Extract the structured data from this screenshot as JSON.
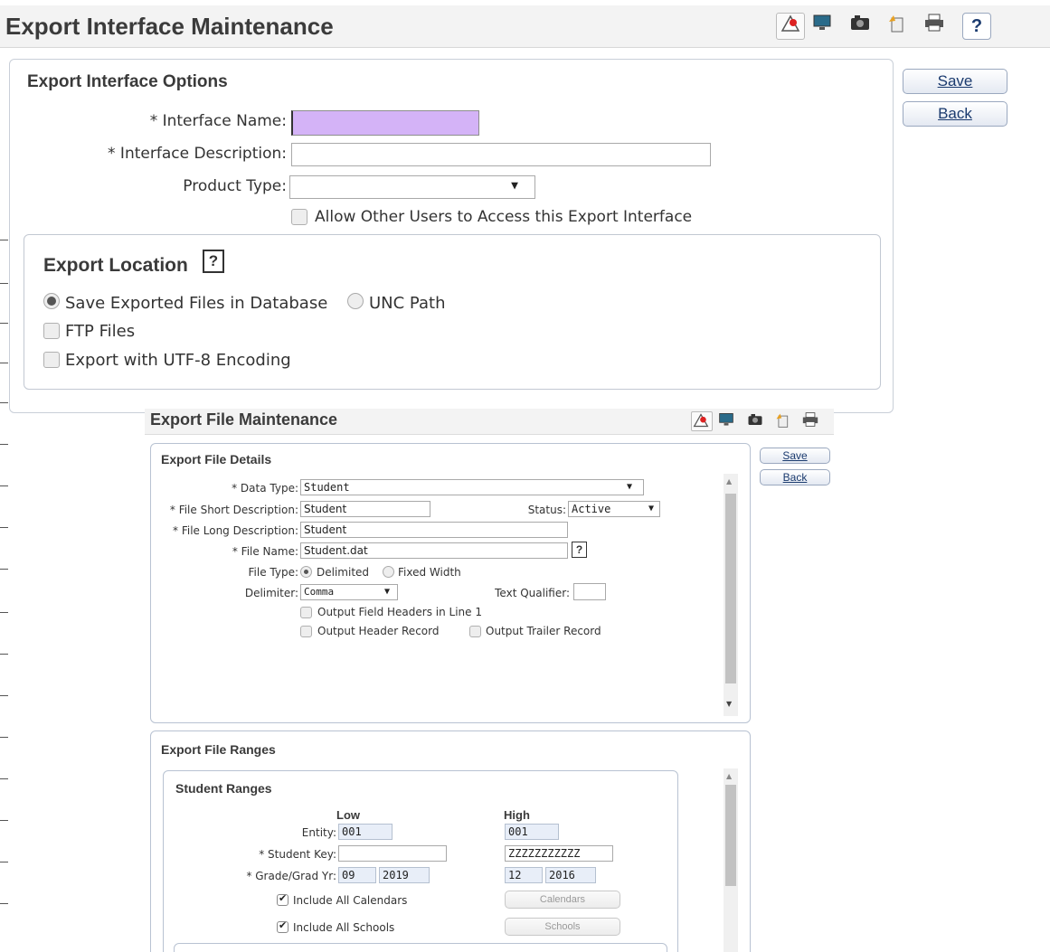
{
  "outer": {
    "title": "Export Interface Maintenance",
    "toolbar_icons": [
      "alert-icon",
      "monitor-icon",
      "camera-icon",
      "document-icon",
      "print-icon",
      "help-icon"
    ],
    "help_label": "?",
    "save_label": "Save",
    "back_label": "Back",
    "options": {
      "title": "Export Interface Options",
      "interface_name_label": "* Interface Name:",
      "interface_name_value": "",
      "interface_description_label": "* Interface Description:",
      "interface_description_value": "",
      "product_type_label": "Product Type:",
      "product_type_value": "",
      "allow_access_label": "Allow Other Users to Access this Export Interface"
    },
    "location": {
      "title": "Export Location",
      "help_label": "?",
      "save_db_label": "Save Exported Files in Database",
      "unc_label": "UNC Path",
      "ftp_label": "FTP Files",
      "utf8_label": "Export with UTF-8 Encoding"
    }
  },
  "inner": {
    "title": "Export File Maintenance",
    "save_label": "Save",
    "back_label": "Back",
    "details": {
      "title": "Export File Details",
      "data_type_label": "* Data Type:",
      "data_type_value": "Student",
      "short_desc_label": "* File Short Description:",
      "short_desc_value": "Student",
      "status_label": "Status:",
      "status_value": "Active",
      "long_desc_label": "* File Long Description:",
      "long_desc_value": "Student",
      "file_name_label": "* File Name:",
      "file_name_value": "Student.dat",
      "help_label": "?",
      "file_type_label": "File Type:",
      "delimited_label": "Delimited",
      "fixed_width_label": "Fixed Width",
      "delimiter_label": "Delimiter:",
      "delimiter_value": "Comma",
      "text_qualifier_label": "Text Qualifier:",
      "text_qualifier_value": "",
      "field_headers_label": "Output Field Headers in Line 1",
      "header_record_label": "Output Header Record",
      "trailer_record_label": "Output Trailer Record"
    },
    "ranges": {
      "title": "Export File Ranges",
      "student_ranges_title": "Student Ranges",
      "low_label": "Low",
      "high_label": "High",
      "entity_label": "Entity:",
      "entity_low": "001",
      "entity_high": "001",
      "student_key_label": "* Student Key:",
      "student_key_low": "",
      "student_key_high": "ZZZZZZZZZZZ",
      "grade_label": "* Grade/Grad Yr:",
      "grade_low": "09",
      "grad_yr_low": "2019",
      "grade_high": "12",
      "grad_yr_high": "2016",
      "include_calendars_label": "Include All Calendars",
      "calendars_button": "Calendars",
      "include_schools_label": "Include All Schools",
      "schools_button": "Schools"
    }
  },
  "colors": {
    "required_highlight": "#d4b3f7",
    "link_blue": "#1a3a6e",
    "panel_border": "#b8c2d2"
  }
}
